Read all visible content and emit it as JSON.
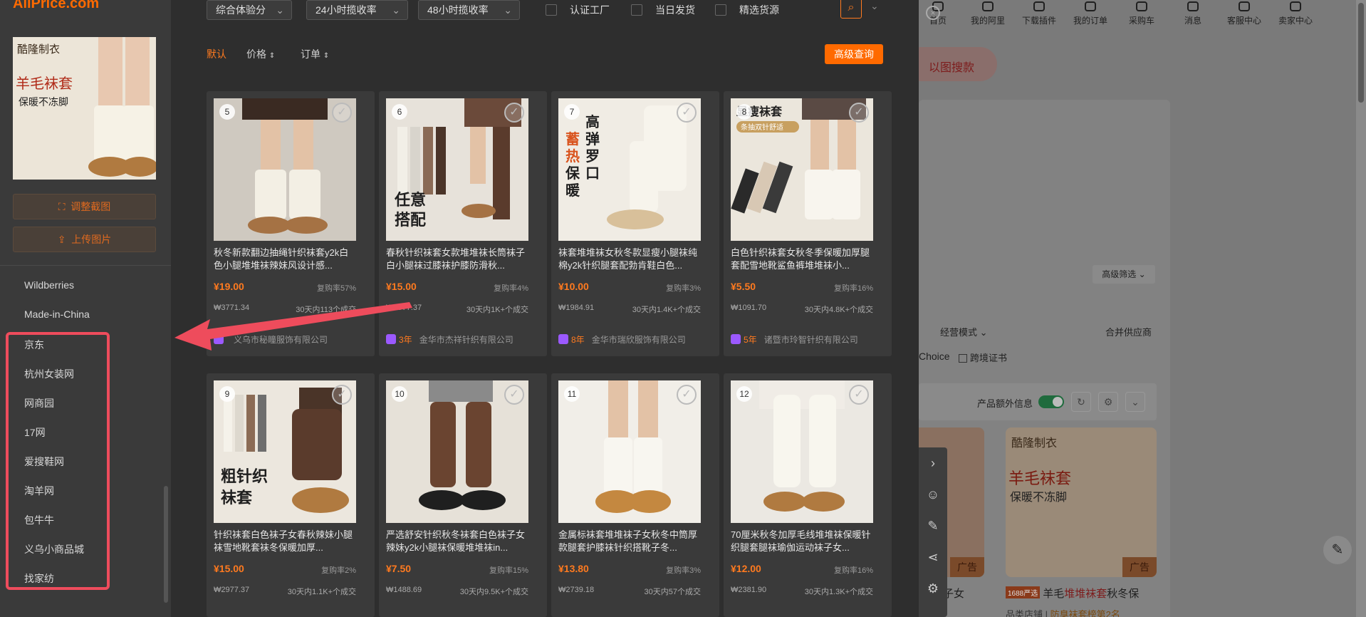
{
  "brand": {
    "logo": "AliPrice.com"
  },
  "left_panel": {
    "thumb_text1": "酷隆制衣",
    "thumb_text2": "羊毛袜套",
    "thumb_text3": "保暖不冻脚",
    "adjust_btn": "调整截图",
    "upload_btn": "上传图片",
    "sites": [
      "Wildberries",
      "Made-in-China",
      "京东",
      "杭州女装网",
      "网商园",
      "17网",
      "爱搜鞋网",
      "淘羊网",
      "包牛牛",
      "义乌小商品城",
      "找家纺"
    ]
  },
  "filters": {
    "sort_select": "综合体验分",
    "rate24": "24小时揽收率",
    "rate48": "48小时揽收率",
    "chk_factory": "认证工厂",
    "chk_sameday": "当日发货",
    "chk_select": "精选货源"
  },
  "sortbar": {
    "default": "默认",
    "price": "价格",
    "order": "订单",
    "advanced": "高级查询"
  },
  "products": [
    {
      "idx": "5",
      "title": "秋冬新款翻边抽绳针织袜套y2k白色小腿堆堆袜辣妹风设计感...",
      "price": "¥19.00",
      "repurchase": "复购率57%",
      "gmv": "₩3771.34",
      "deals": "30天内113个成交",
      "years": "",
      "shop": "义乌市秘瞳服饰有限公司"
    },
    {
      "idx": "6",
      "title": "春秋针织袜套女款堆堆袜长筒袜子白小腿袜过膝袜护膝防滑秋...",
      "price": "¥15.00",
      "repurchase": "复购率4%",
      "gmv": "₩2977.37",
      "deals": "30天内1K+个成交",
      "years": "3年",
      "shop": "金华市杰祥针织有限公司"
    },
    {
      "idx": "7",
      "title": "袜套堆堆袜女秋冬款显瘦小腿袜纯棉y2k针织腿套配勃肯鞋白色...",
      "price": "¥10.00",
      "repurchase": "复购率3%",
      "gmv": "₩1984.91",
      "deals": "30天内1.4K+个成交",
      "years": "8年",
      "shop": "金华市瑞欣服饰有限公司"
    },
    {
      "idx": "8",
      "title": "白色针织袜套女秋冬季保暖加厚腿套配雪地靴鲨鱼裤堆堆袜小...",
      "price": "¥5.50",
      "repurchase": "复购率16%",
      "gmv": "₩1091.70",
      "deals": "30天内4.8K+个成交",
      "years": "5年",
      "shop": "诸暨市玲智针织有限公司"
    },
    {
      "idx": "9",
      "title": "针织袜套白色袜子女春秋辣妹小腿袜雪地靴套袜冬保暖加厚...",
      "price": "¥15.00",
      "repurchase": "复购率2%",
      "gmv": "₩2977.37",
      "deals": "30天内1.1K+个成交",
      "years": "",
      "shop": ""
    },
    {
      "idx": "10",
      "title": "严选舒安针织秋冬袜套白色袜子女辣妹y2k小腿袜保暖堆堆袜in...",
      "price": "¥7.50",
      "repurchase": "复购率15%",
      "gmv": "₩1488.69",
      "deals": "30天内9.5K+个成交",
      "years": "",
      "shop": ""
    },
    {
      "idx": "11",
      "title": "金属标袜套堆堆袜子女秋冬中筒厚款腿套护膝袜针织搭靴子冬...",
      "price": "¥13.80",
      "repurchase": "复购率3%",
      "gmv": "₩2739.18",
      "deals": "30天内57个成交",
      "years": "",
      "shop": ""
    },
    {
      "idx": "12",
      "title": "70厘米秋冬加厚毛线堆堆袜保暖针织腿套腿袜瑜伽运动袜子女...",
      "price": "¥12.00",
      "repurchase": "复购率16%",
      "gmv": "₩2381.90",
      "deals": "30天内1.3K+个成交",
      "years": "",
      "shop": ""
    }
  ],
  "img_texts": {
    "p6": "任意\n搭配",
    "p7a": "高弹罗口",
    "p7b": "蓄热保暖",
    "p8a": "显瘦袜套",
    "p8b": "条抽双针舒适",
    "p9": "粗针织\n袜套"
  },
  "bg_page": {
    "nav": [
      "首页",
      "我的阿里",
      "下载插件",
      "我的订单",
      "采购车",
      "消息",
      "客服中心",
      "卖家中心"
    ],
    "img_search": "以图搜款",
    "adv_filter": "高级筛选",
    "biz_mode": "经营模式",
    "merge": "合并供应商",
    "choice": "Choice",
    "cross": "跨境证书",
    "extra_info": "产品额外信息",
    "ad": "广告",
    "p1_title": "堆袜子女",
    "p2_tag": "1688严选",
    "p2_title_a": "羊毛",
    "p2_title_b": "堆堆袜套",
    "p2_title_c": "秋冬保",
    "p2_shop_a": "品类店铺",
    "p2_shop_b": "防臭袜套榜第2名",
    "thumb_text1": "酷隆制衣",
    "thumb_text2": "羊毛袜套",
    "thumb_text3": "保暖不冻脚"
  },
  "colors": {
    "accent": "#ff6a00",
    "annotation": "#ee4c5c"
  }
}
